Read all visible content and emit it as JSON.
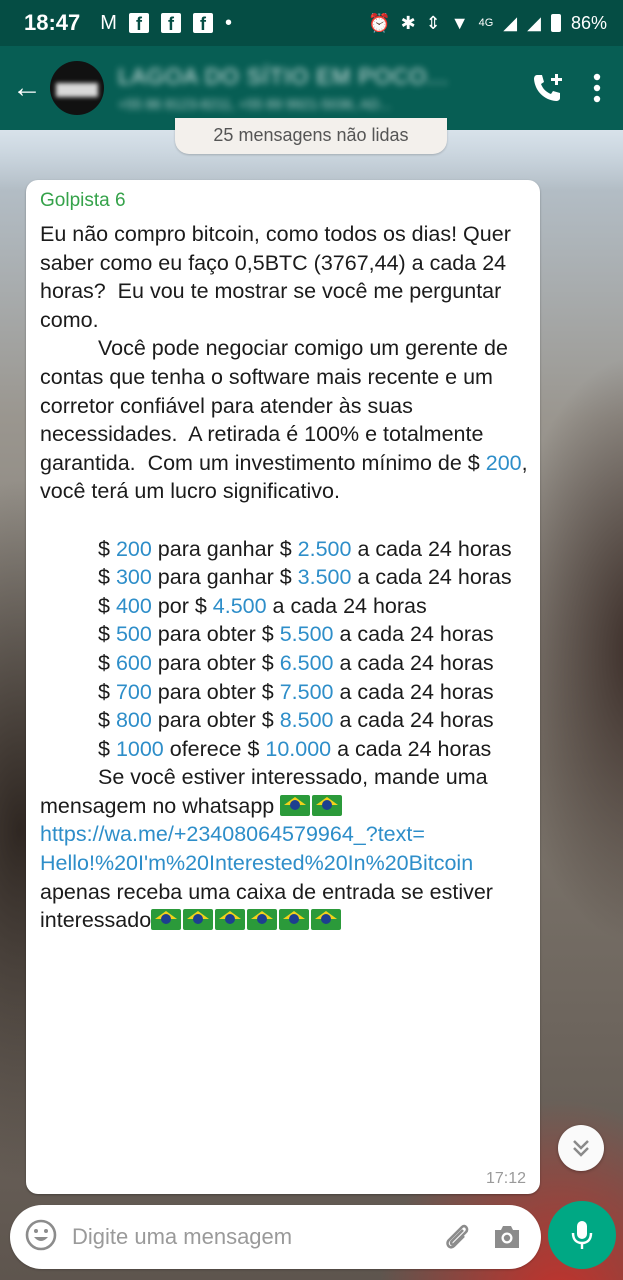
{
  "status_bar": {
    "time": "18:47",
    "battery": "86%",
    "network": "4G"
  },
  "header": {
    "chat_title": "LAGOA DO SÍTIO EM POCO...",
    "chat_subtitle": "+55 86 8123-8211, +55 89 9921-5036, AD..."
  },
  "unread_banner": "25 mensagens não lidas",
  "message": {
    "sender": "Golpista 6",
    "time": "17:12",
    "intro": "Eu não compro bitcoin, como todos os dias! Quer saber como eu faço 0,5BTC (3767,44) a cada 24 horas?  Eu vou te mostrar se você me perguntar como.",
    "p2": "Você pode negociar comigo um gerente de contas que tenha o software mais recente e um corretor confiável para atender às suas necessidades.  A retirada é 100% e totalmente garantida.  Com um investimento mínimo de $ ",
    "p2_amount": "200",
    "p2_end": ", você terá um lucro significativo.",
    "offers": [
      {
        "a": "200",
        "mid": " para ganhar $ ",
        "b": "2.500",
        "end": " a cada 24 horas"
      },
      {
        "a": "300",
        "mid": " para ganhar $ ",
        "b": "3.500",
        "end": " a cada 24 horas"
      },
      {
        "a": "400",
        "mid": " por $ ",
        "b": "4.500",
        "end": " a cada 24 horas"
      },
      {
        "a": "500",
        "mid": " para obter $ ",
        "b": "5.500",
        "end": " a cada 24 horas"
      },
      {
        "a": "600",
        "mid": " para obter $ ",
        "b": "6.500",
        "end": " a cada 24 horas"
      },
      {
        "a": "700",
        "mid": " para obter $ ",
        "b": "7.500",
        "end": " a cada 24 horas"
      },
      {
        "a": "800",
        "mid": " para obter $ ",
        "b": "8.500",
        "end": " a cada 24 horas"
      },
      {
        "a": "1000",
        "mid": " oferece $ ",
        "b": "10.000",
        "end": " a cada 24 horas"
      }
    ],
    "closing": "Se você estiver interessado, mande uma mensagem no whatsapp ",
    "link_1": "https://wa.me/+23408064579964_?text=",
    "link_2": "Hello!%20I'm%20Interested%20In%20Bitcoin",
    "tail": "apenas receba uma caixa de entrada se estiver interessado"
  },
  "composer": {
    "placeholder": "Digite uma mensagem"
  },
  "colors": {
    "header": "#075e54",
    "status": "#054d44",
    "sender": "#35a24a",
    "link": "#2e8ec9",
    "send_button": "#00a884"
  }
}
